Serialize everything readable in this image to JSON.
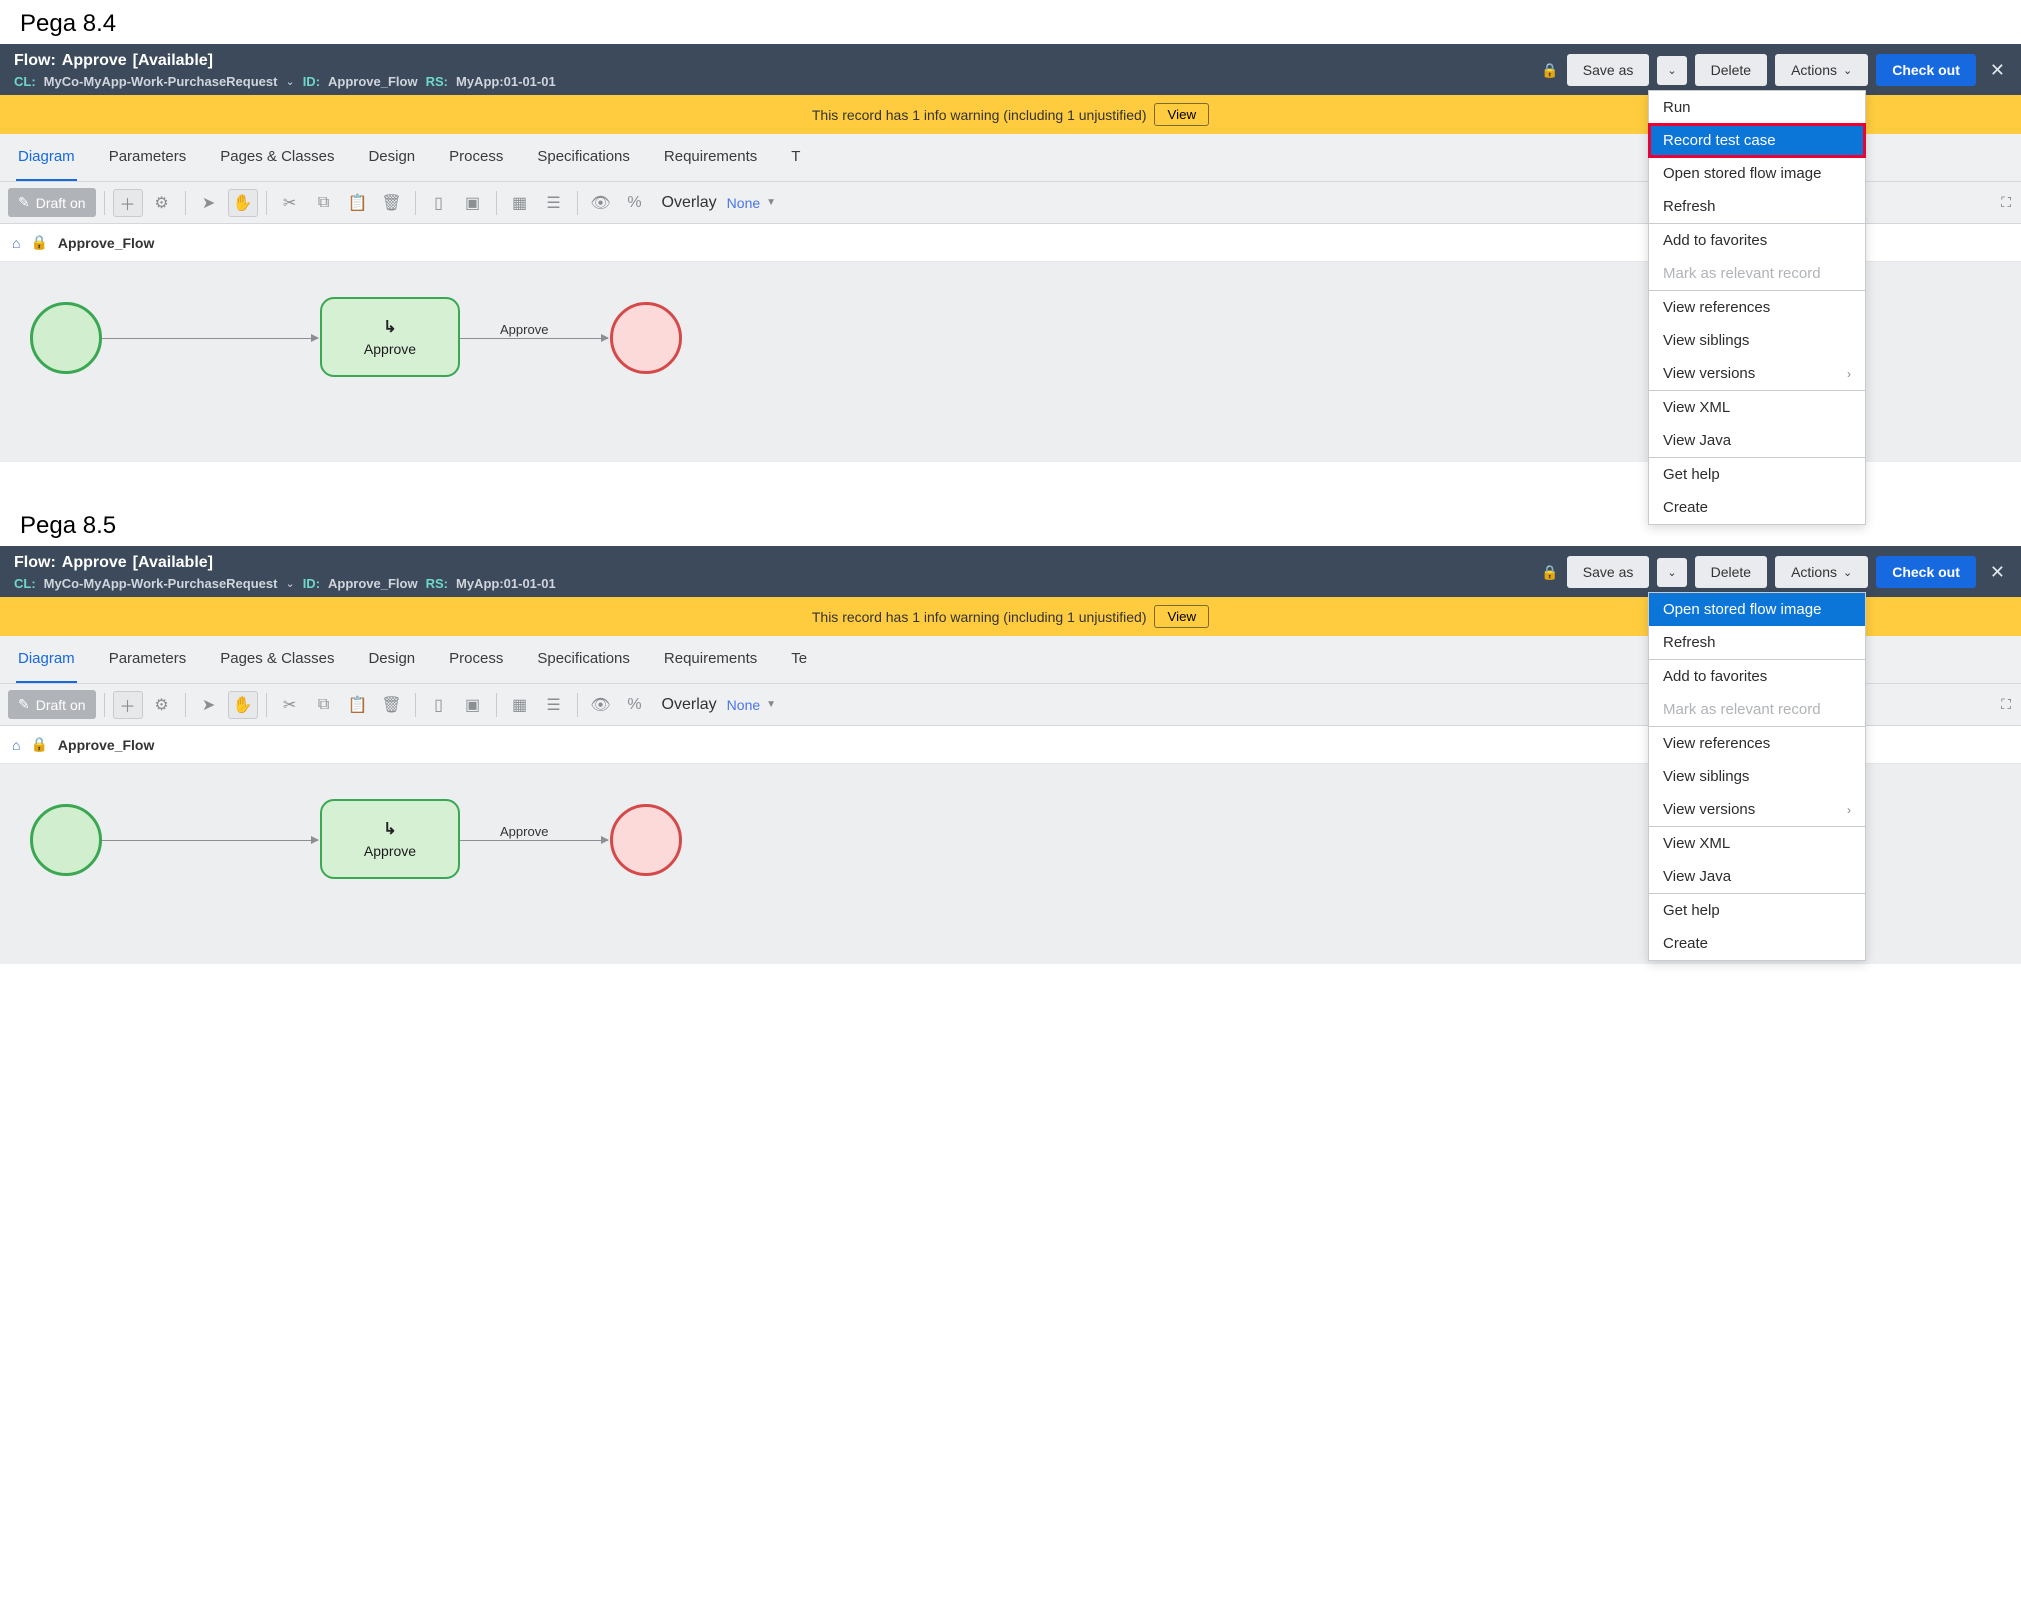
{
  "versions": {
    "v84": {
      "label": "Pega 8.4"
    },
    "v85": {
      "label": "Pega 8.5"
    }
  },
  "header": {
    "title_prefix": "Flow:",
    "title_name": "Approve",
    "status": "[Available]",
    "cl_label": "CL:",
    "cl_value": "MyCo-MyApp-Work-PurchaseRequest",
    "id_label": "ID:",
    "id_value": "Approve_Flow",
    "rs_label": "RS:",
    "rs_value": "MyApp:01-01-01",
    "save_as": "Save as",
    "delete": "Delete",
    "actions": "Actions",
    "checkout": "Check out"
  },
  "warning": {
    "text": "This record has 1 info warning (including 1 unjustified)",
    "view": "View"
  },
  "tabs": {
    "diagram": "Diagram",
    "parameters": "Parameters",
    "pages": "Pages & Classes",
    "design": "Design",
    "process": "Process",
    "specs": "Specifications",
    "reqs": "Requirements",
    "testcases84": "T",
    "testcases85": "Te"
  },
  "toolbar": {
    "draft": "Draft on",
    "overlay_label": "Overlay",
    "overlay_value": "None"
  },
  "breadcrumb": {
    "label": "Approve_Flow"
  },
  "flow": {
    "task_label": "Approve",
    "edge_label": "Approve"
  },
  "menu84": {
    "run": "Run",
    "record": "Record test case",
    "open_image": "Open stored flow image",
    "refresh": "Refresh",
    "add_fav": "Add to favorites",
    "mark_relevant": "Mark as relevant record",
    "view_refs": "View references",
    "view_siblings": "View siblings",
    "view_versions": "View versions",
    "view_xml": "View XML",
    "view_java": "View Java",
    "get_help": "Get help",
    "create": "Create"
  },
  "menu85": {
    "open_image": "Open stored flow image",
    "refresh": "Refresh",
    "add_fav": "Add to favorites",
    "mark_relevant": "Mark as relevant record",
    "view_refs": "View references",
    "view_siblings": "View siblings",
    "view_versions": "View versions",
    "view_xml": "View XML",
    "view_java": "View Java",
    "get_help": "Get help",
    "create": "Create"
  }
}
